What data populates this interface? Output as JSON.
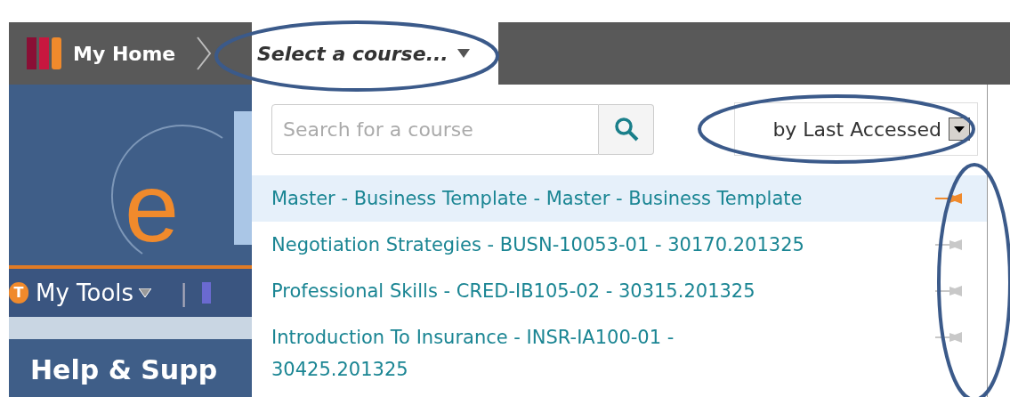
{
  "top_bar": {
    "home_label": "My Home",
    "course_selector": "Select a course..."
  },
  "course_menu": {
    "search": {
      "placeholder": "Search for a course"
    },
    "sort": {
      "value": "by Last Accessed"
    },
    "courses": [
      {
        "name": "Master - Business Template - Master - Business Template",
        "selected": true,
        "pinned": true
      },
      {
        "name": "Negotiation Strategies - BUSN-10053-01 - 30170.201325",
        "selected": false,
        "pinned": false
      },
      {
        "name": "Professional Skills - CRED-IB105-02 - 30315.201325",
        "selected": false,
        "pinned": false
      },
      {
        "name": "Introduction To Insurance - INSR-IA100-01 -\n30425.201325",
        "selected": false,
        "pinned": false
      }
    ]
  },
  "side_panel": {
    "logo_text": "e",
    "tools_badge": "T",
    "tools_label": "My Tools",
    "separator": "|",
    "card_title": "Help & Supp"
  }
}
